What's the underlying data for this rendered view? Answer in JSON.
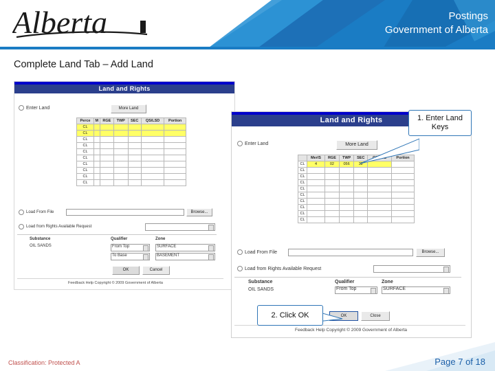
{
  "header": {
    "line1": "Postings",
    "line2": "Government of Alberta",
    "logo_text": "Alberta",
    "bg_color": "#1a7cc4"
  },
  "slide": {
    "title": "Complete Land Tab – Add Land"
  },
  "callouts": [
    {
      "id": "callout-1",
      "text": "1. Enter Land Keys",
      "border_color": "#2e75b6"
    },
    {
      "id": "callout-2",
      "text": "2. Click OK",
      "border_color": "#2e75b6"
    }
  ],
  "screenshot_left": {
    "app_title": "Land and Rights",
    "section_enter_land": "Enter Land",
    "button_more_land": "More Land",
    "grid_headers": [
      "Perce",
      "M",
      "RGE",
      "TWP",
      "SEC",
      "QS/LSD",
      "Portion"
    ],
    "grid_rows": [
      [
        "CL",
        "",
        "",
        "",
        "",
        "",
        ""
      ],
      [
        "CL",
        "",
        "",
        "",
        "",
        "",
        ""
      ],
      [
        "CL",
        "",
        "",
        "",
        "",
        "",
        ""
      ],
      [
        "CL",
        "",
        "",
        "",
        "",
        "",
        ""
      ],
      [
        "CL",
        "",
        "",
        "",
        "",
        "",
        ""
      ],
      [
        "CL",
        "",
        "",
        "",
        "",
        "",
        ""
      ],
      [
        "CL",
        "",
        "",
        "",
        "",
        "",
        ""
      ],
      [
        "CL",
        "",
        "",
        "",
        "",
        "",
        ""
      ],
      [
        "CL",
        "",
        "",
        "",
        "",
        "",
        ""
      ],
      [
        "CL",
        "",
        "",
        "",
        "",
        "",
        ""
      ]
    ],
    "load_from_file_label": "Load From File",
    "browse_button": "Browse...",
    "load_rights_label": "Load from Rights Available Request",
    "substance_label": "Substance",
    "substance_value": "OIL SANDS",
    "qualifier_label": "Qualifier",
    "qualifier_value": "From Top",
    "zone_label": "Zone",
    "zone_value": "SURFACE",
    "qualifier_value2": "To Base",
    "zone_value2": "BASEMENT",
    "ok_button": "OK",
    "cancel_button": "Cancel",
    "footer_links": "Feedback  Help   Copyright © 2009 Government of Alberta"
  },
  "screenshot_right": {
    "app_title": "Land and Rights",
    "section_enter_land": "Enter Land",
    "button_more_land": "More Land",
    "grid_headers": [
      "Mer/S",
      "RGE",
      "TWP",
      "SEC",
      "QS/LSD",
      "Portion"
    ],
    "filled_row": [
      "4",
      "02",
      "056",
      "32",
      "",
      ""
    ],
    "grid_row_label": "CL",
    "grid_rows_count": 10,
    "load_from_file_label": "Load From File",
    "browse_button": "Browse...",
    "load_rights_label": "Load from Rights Available Request",
    "substance_label": "Substance",
    "substance_value": "OIL SANDS",
    "qualifier_label": "Qualifier",
    "qualifier_value": "From Top",
    "zone_label": "Zone",
    "zone_value": "SURFACE",
    "ok_button": "OK",
    "cancel_button": "Close",
    "footer_links": "Feedback  Help   Copyright © 2009 Government of Alberta"
  },
  "footer": {
    "classification": "Classification: Protected A",
    "page": "Page 7 of 18",
    "page_color": "#1a5fa8",
    "classification_color": "#c0504d"
  }
}
